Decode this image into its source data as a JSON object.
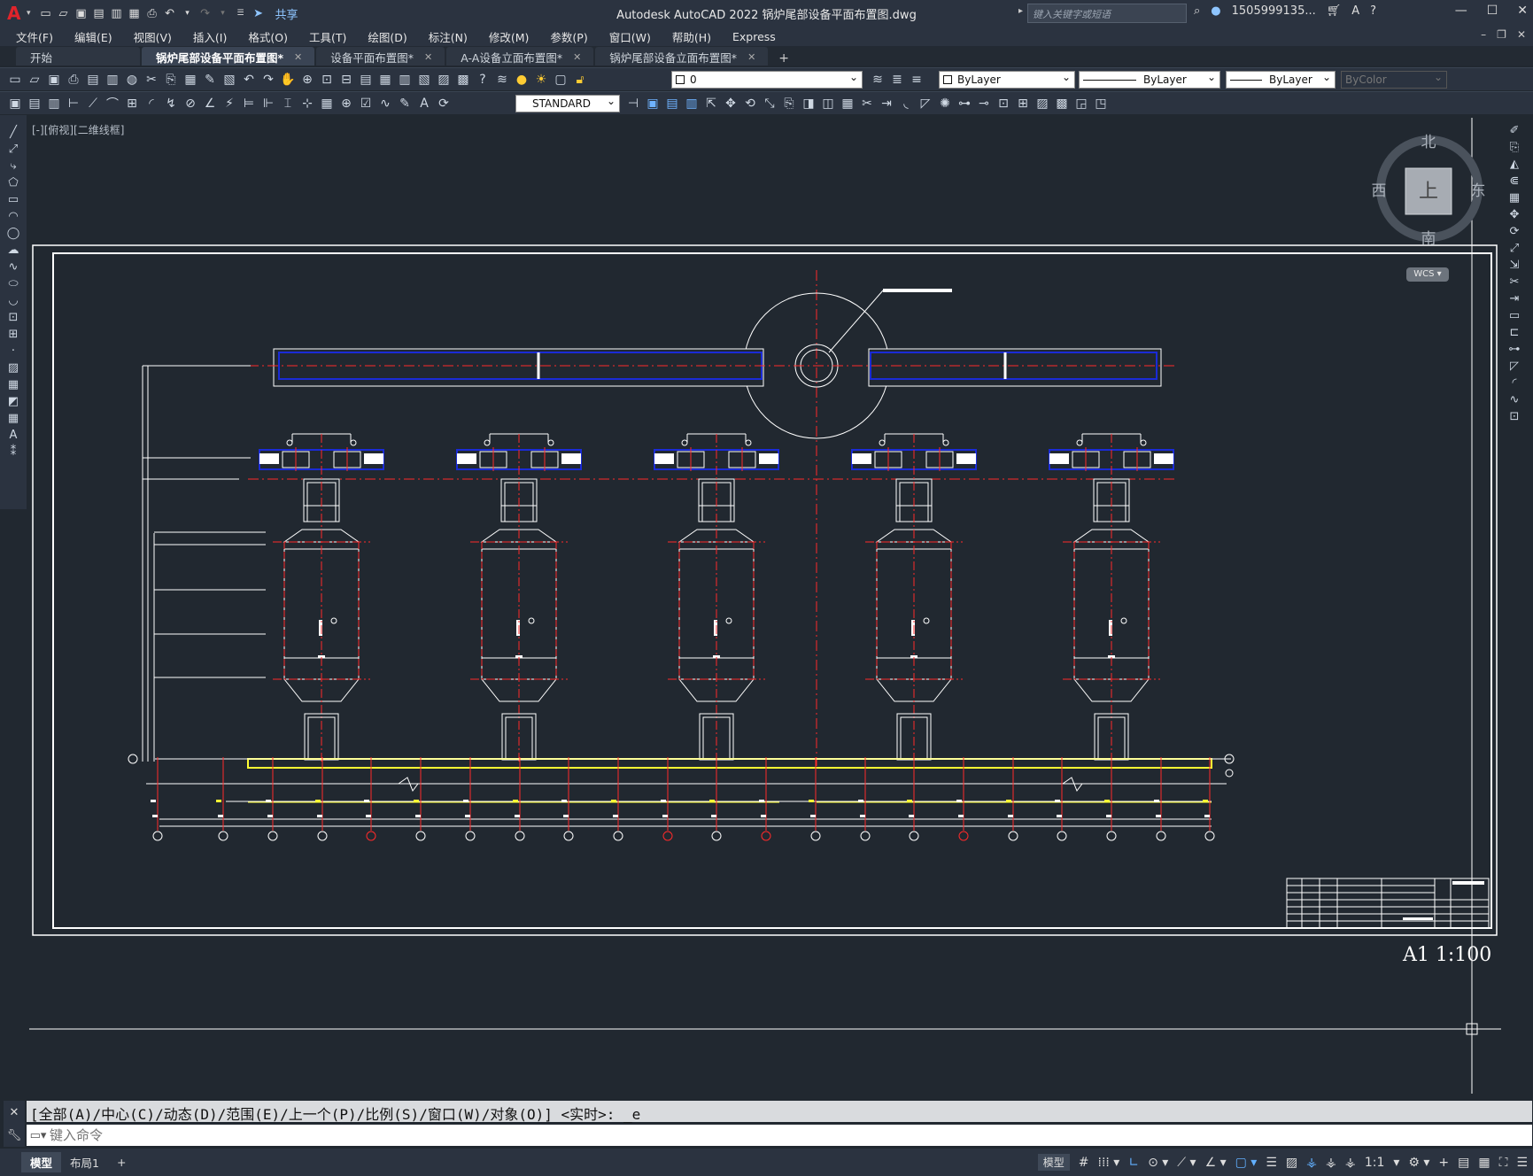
{
  "app": {
    "logo": "A",
    "title": "Autodesk AutoCAD 2022    锅炉尾部设备平面布置图.dwg",
    "share_label": "共享",
    "search_placeholder": "键入关键字或短语",
    "user": "1505999135...",
    "help": "?"
  },
  "menu": [
    "文件(F)",
    "编辑(E)",
    "视图(V)",
    "插入(I)",
    "格式(O)",
    "工具(T)",
    "绘图(D)",
    "标注(N)",
    "修改(M)",
    "参数(P)",
    "窗口(W)",
    "帮助(H)",
    "Express"
  ],
  "tabs": [
    {
      "label": "开始",
      "closable": false,
      "active": false
    },
    {
      "label": "锅炉尾部设备平面布置图*",
      "closable": true,
      "active": true
    },
    {
      "label": "设备平面布置图*",
      "closable": true,
      "active": false
    },
    {
      "label": "A-A设备立面布置图*",
      "closable": true,
      "active": false
    },
    {
      "label": "锅炉尾部设备立面布置图*",
      "closable": true,
      "active": false
    }
  ],
  "tab_add": "+",
  "toolbar": {
    "layer_value": "0",
    "color_value": "ByLayer",
    "linetype_value": "ByLayer",
    "lineweight_value": "ByLayer",
    "plotstyle_value": "ByColor",
    "textstyle_value": "STANDARD"
  },
  "viewport": {
    "label": "[-][俯视][二维线框]",
    "compass": {
      "north": "北",
      "south": "南",
      "east": "东",
      "west": "西",
      "face": "上"
    },
    "wcs": "WCS",
    "scale_text": "A1 1:100"
  },
  "command": {
    "history": "[全部(A)/中心(C)/动态(D)/范围(E)/上一个(P)/比例(S)/窗口(W)/对象(O)] <实时>: _e",
    "placeholder": "键入命令"
  },
  "status": {
    "layout_tabs": [
      "模型",
      "布局1"
    ],
    "add": "+",
    "model_button": "模型",
    "scale": "1:1"
  },
  "colors": {
    "background": "#212830",
    "accent_red": "#e0242b",
    "drawing_red": "#ff2a2a",
    "drawing_blue": "#1a2bd6",
    "drawing_yellow": "#ffff33"
  }
}
